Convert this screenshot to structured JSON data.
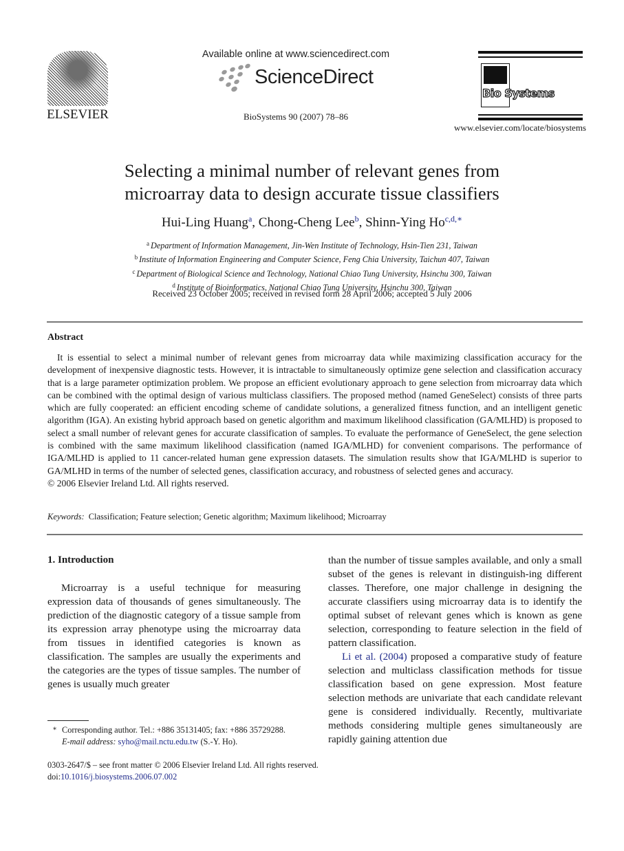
{
  "header": {
    "publisher_logo_label": "ELSEVIER",
    "available_online": "Available online at www.sciencedirect.com",
    "sciencedirect_label": "ScienceDirect",
    "journal_reference": "BioSystems 90 (2007) 78–86",
    "journal_logo_label": "Bio Systems",
    "journal_url": "www.elsevier.com/locate/biosystems"
  },
  "article": {
    "title_line1": "Selecting a minimal number of relevant genes from",
    "title_line2": "microarray data to design accurate tissue classifiers",
    "authors": [
      {
        "name": "Hui-Ling Huang",
        "sup": "a",
        "sep": ", "
      },
      {
        "name": "Chong-Cheng Lee",
        "sup": "b",
        "sep": ", "
      },
      {
        "name": "Shinn-Ying Ho",
        "sup": "c,d,∗",
        "sep": ""
      }
    ],
    "affiliations": [
      {
        "mark": "a",
        "text": "Department of Information Management, Jin-Wen Institute of Technology, Hsin-Tien 231, Taiwan"
      },
      {
        "mark": "b",
        "text": "Institute of Information Engineering and Computer Science, Feng Chia University, Taichun 407, Taiwan"
      },
      {
        "mark": "c",
        "text": "Department of Biological Science and Technology, National Chiao Tung University, Hsinchu 300, Taiwan"
      },
      {
        "mark": "d",
        "text": "Institute of Bioinformatics, National Chiao Tung University, Hsinchu 300, Taiwan"
      }
    ],
    "received": "Received 23 October 2005; received in revised form 28 April 2006; accepted 5 July 2006"
  },
  "abstract": {
    "heading": "Abstract",
    "body": "It is essential to select a minimal number of relevant genes from microarray data while maximizing classification accuracy for the development of inexpensive diagnostic tests. However, it is intractable to simultaneously optimize gene selection and classification accuracy that is a large parameter optimization problem. We propose an efficient evolutionary approach to gene selection from microarray data which can be combined with the optimal design of various multiclass classifiers. The proposed method (named GeneSelect) consists of three parts which are fully cooperated: an efficient encoding scheme of candidate solutions, a generalized fitness function, and an intelligent genetic algorithm (IGA). An existing hybrid approach based on genetic algorithm and maximum likelihood classification (GA/MLHD) is proposed to select a small number of relevant genes for accurate classification of samples. To evaluate the performance of GeneSelect, the gene selection is combined with the same maximum likelihood classification (named IGA/MLHD) for convenient comparisons. The performance of IGA/MLHD is applied to 11 cancer-related human gene expression datasets. The simulation results show that IGA/MLHD is superior to GA/MLHD in terms of the number of selected genes, classification accuracy, and robustness of selected genes and accuracy.",
    "copyright": "© 2006 Elsevier Ireland Ltd. All rights reserved.",
    "keywords_label": "Keywords:",
    "keywords": "Classification; Feature selection; Genetic algorithm; Maximum likelihood; Microarray"
  },
  "introduction": {
    "heading": "1.  Introduction",
    "para1_left": "Microarray is a useful technique for measuring expression data of thousands of genes simultaneously. The prediction of the diagnostic category of a tissue sample from its expression array phenotype using the microarray data from tissues in identified categories is known as classification. The samples are usually the experiments and the categories are the types of tissue samples. The number of genes is usually much greater",
    "para1_right": "than the number of tissue samples available, and only a small subset of the genes is relevant in distinguish-ing different classes. Therefore, one major challenge in designing the accurate classifiers using microarray data is to identify the optimal subset of relevant genes which is known as gene selection, corresponding to feature selection in the field of pattern classification.",
    "para2_citation": "Li et al. (2004)",
    "para2_rest": " proposed a comparative study of feature selection and multiclass classification methods for tissue classification based on gene expression. Most feature selection methods are univariate that each candidate relevant gene is considered individually. Recently, multivariate methods considering multiple genes simultaneously are rapidly gaining attention due"
  },
  "footnote": {
    "star": "∗",
    "corresponding": "Corresponding author. Tel.: +886 35131405; fax: +886 35729288.",
    "email_label": "E-mail address:",
    "email": "syho@mail.nctu.edu.tw",
    "email_suffix": " (S.-Y. Ho)."
  },
  "front_matter": {
    "issn_line": "0303-2647/$ – see front matter © 2006 Elsevier Ireland Ltd. All rights reserved.",
    "doi_label": "doi:",
    "doi": "10.1016/j.biosystems.2006.07.002"
  }
}
